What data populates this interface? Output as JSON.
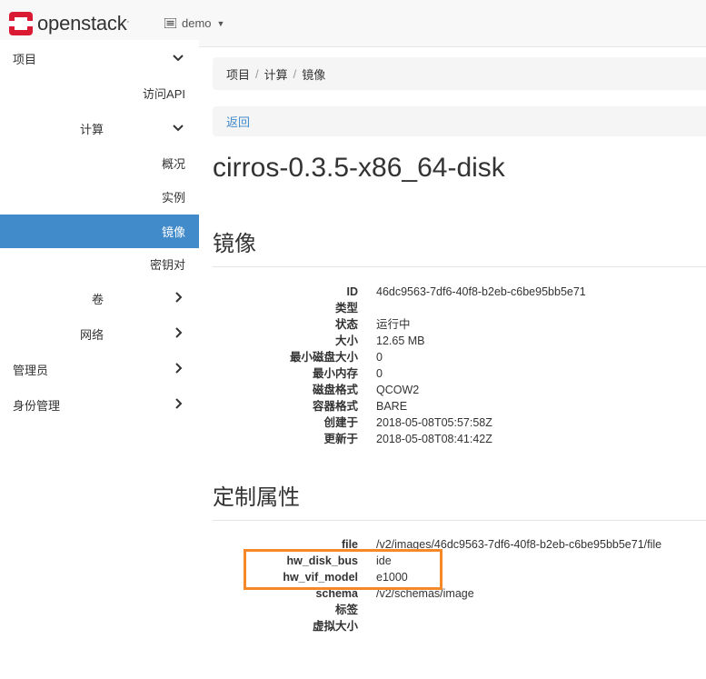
{
  "header": {
    "logo_text": "openstack",
    "logo_tm": ".",
    "project": "demo"
  },
  "sidebar": {
    "items": [
      {
        "label": "项目",
        "level": 1,
        "chevron": "down"
      },
      {
        "label": "访问API",
        "level": 3
      },
      {
        "label": "计算",
        "level": 2,
        "chevron": "down"
      },
      {
        "label": "概况",
        "level": 3
      },
      {
        "label": "实例",
        "level": 3
      },
      {
        "label": "镜像",
        "level": 3,
        "active": true
      },
      {
        "label": "密钥对",
        "level": 3
      },
      {
        "label": "卷",
        "level": 2,
        "chevron": "right"
      },
      {
        "label": "网络",
        "level": 2,
        "chevron": "right"
      },
      {
        "label": "管理员",
        "level": 1,
        "chevron": "right"
      },
      {
        "label": "身份管理",
        "level": 1,
        "chevron": "right"
      }
    ]
  },
  "breadcrumb": [
    "项目",
    "计算",
    "镜像"
  ],
  "back_label": "返回",
  "page_title": "cirros-0.3.5-x86_64-disk",
  "image_section": {
    "title": "镜像",
    "rows": [
      {
        "label": "ID",
        "value": "46dc9563-7df6-40f8-b2eb-c6be95bb5e71"
      },
      {
        "label": "类型",
        "value": ""
      },
      {
        "label": "状态",
        "value": "运行中"
      },
      {
        "label": "大小",
        "value": "12.65 MB"
      },
      {
        "label": "最小磁盘大小",
        "value": "0"
      },
      {
        "label": "最小内存",
        "value": "0"
      },
      {
        "label": "磁盘格式",
        "value": "QCOW2"
      },
      {
        "label": "容器格式",
        "value": "BARE"
      },
      {
        "label": "创建于",
        "value": "2018-05-08T05:57:58Z"
      },
      {
        "label": "更新于",
        "value": "2018-05-08T08:41:42Z"
      }
    ]
  },
  "custom_section": {
    "title": "定制属性",
    "rows": [
      {
        "label": "file",
        "value": "/v2/images/46dc9563-7df6-40f8-b2eb-c6be95bb5e71/file"
      },
      {
        "label": "hw_disk_bus",
        "value": "ide"
      },
      {
        "label": "hw_vif_model",
        "value": "e1000"
      },
      {
        "label": "schema",
        "value": "/v2/schemas/image"
      },
      {
        "label": "标签",
        "value": ""
      },
      {
        "label": "虚拟大小",
        "value": ""
      }
    ]
  },
  "colors": {
    "accent": "#428bca",
    "highlight": "#f5892a",
    "logo_red": "#da1a32"
  }
}
